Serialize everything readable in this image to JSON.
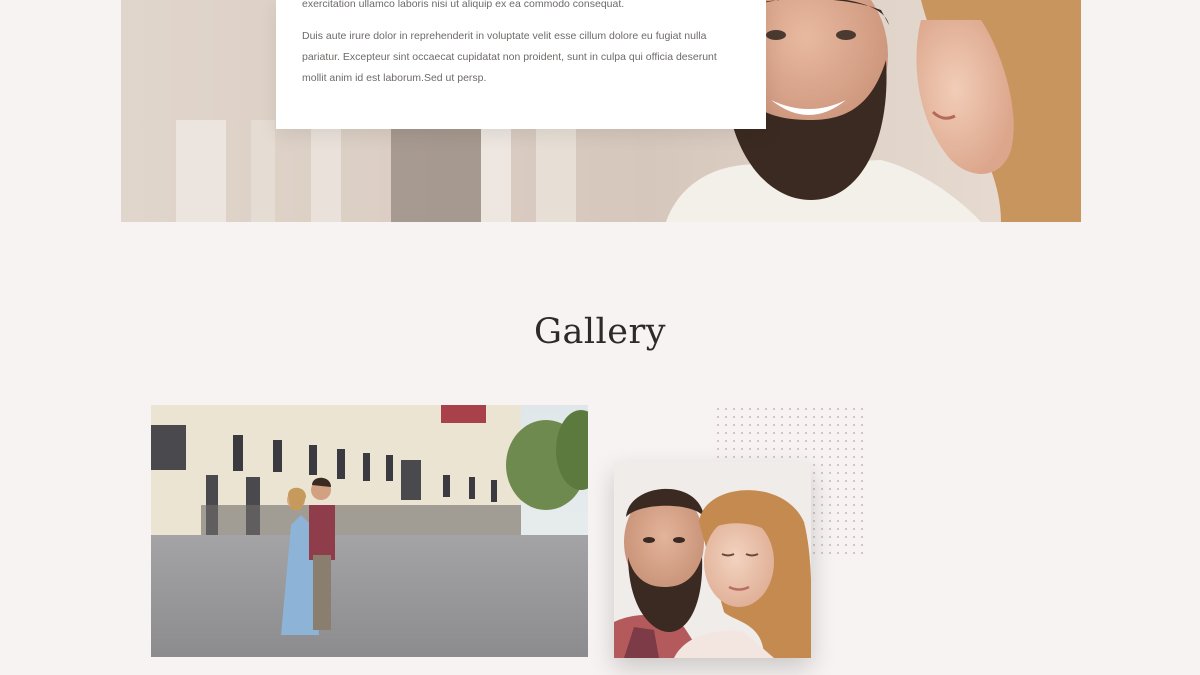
{
  "hero": {
    "paragraph_1_tail": "exercitation ullamco laboris nisi ut aliquip ex ea commodo consequat.",
    "paragraph_2": "Duis aute irure dolor in reprehenderit in voluptate velit esse cillum dolore eu fugiat nulla pariatur. Excepteur sint occaecat cupidatat non proident, sunt in culpa qui officia deserunt mollit anim id est laborum.Sed ut persp.",
    "photo_icon": "couple-smiling-photo"
  },
  "gallery": {
    "title": "Gallery",
    "photo_1_icon": "couple-plaza-photo",
    "photo_2_icon": "couple-portrait-photo"
  },
  "colors": {
    "background": "#f7f3f2",
    "heading": "#2e2a28",
    "body_text": "#6e6a68",
    "dot_accent": "#d9c2c4"
  }
}
